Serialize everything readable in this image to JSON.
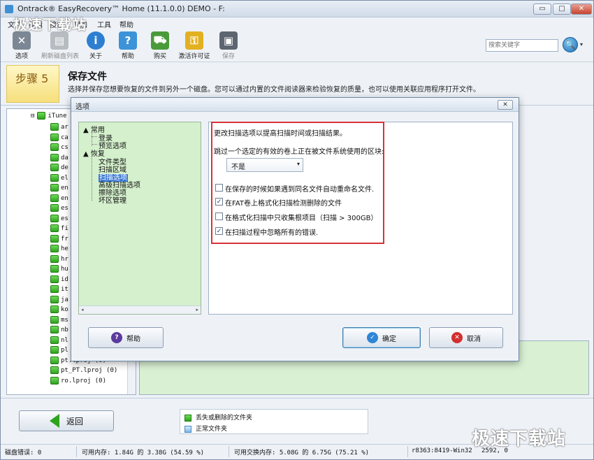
{
  "window": {
    "title": "Ontrack® EasyRecovery™ Home (11.1.0.0) DEMO - F:",
    "minimize_glyph": "▭",
    "maximize_glyph": "□",
    "close_glyph": "✕"
  },
  "menu": [
    "文件",
    "编辑",
    "搜索",
    "附加",
    "工具",
    "帮助"
  ],
  "toolbar": [
    {
      "label": "选项",
      "icon": "tools-icon"
    },
    {
      "label": "刷新磁盘列表",
      "icon": "disk-refresh-icon",
      "disabled": true
    },
    {
      "label": "关于",
      "icon": "info-icon"
    },
    {
      "label": "帮助",
      "icon": "help-icon"
    },
    {
      "label": "购买",
      "icon": "cart-icon"
    },
    {
      "label": "激活许可证",
      "icon": "key-icon"
    },
    {
      "label": "保存",
      "icon": "save-icon",
      "disabled": true
    }
  ],
  "search": {
    "placeholder": "搜索关键字",
    "button_glyph": "🔍",
    "chevron": "▾"
  },
  "step": {
    "label": "步骤 5",
    "title": "保存文件",
    "description": "选择并保存您想要恢复的文件到另外一个磁盘。您可以通过内置的文件阅读器来检验恢复的质量，也可以使用关联应用程序打开文件。"
  },
  "file_tree": {
    "root": "iTune",
    "items": [
      "ar",
      "ca",
      "cs",
      "da",
      "de",
      "el",
      "en",
      "en",
      "es",
      "es",
      "fi",
      "fr",
      "he",
      "hr",
      "hu",
      "id",
      "it",
      "ja",
      "ko",
      "ms",
      "nb",
      "nl",
      "pl",
      "pt.lproj (0)",
      "pt_PT.lproj (0)",
      "ro.lproj (0)"
    ]
  },
  "dialog": {
    "title": "选项",
    "close_glyph": "✕",
    "tree": {
      "groups": [
        {
          "label": "常用",
          "children": [
            "登录",
            "预览选项"
          ]
        },
        {
          "label": "恢复",
          "children": [
            "文件类型",
            "扫描区域",
            "扫描选项",
            "高级扫描选项",
            "擦除选项",
            "坏区管理"
          ]
        }
      ],
      "selected": "扫描选项",
      "scroll_left": "◂",
      "scroll_right": "▸"
    },
    "settings": {
      "heading": "更改扫描选项以提高扫描时间或扫描结果。",
      "skip_label": "跳过一个选定的有效的卷上正在被文件系统使用的区块:",
      "skip_value": "不是",
      "dropdown_arrow": "▾",
      "options": [
        {
          "label": "在保存的时候如果遇到同名文件自动重命名文件.",
          "checked": false
        },
        {
          "label": "在FAT卷上格式化扫描检测删除的文件",
          "checked": true
        },
        {
          "label": "在格式化扫描中只收集根项目（扫描 > 300GB）",
          "checked": false
        },
        {
          "label": "在扫描过程中忽略所有的错误.",
          "checked": true
        }
      ],
      "check_glyph": "✓"
    },
    "buttons": {
      "help": "帮助",
      "help_glyph": "?",
      "ok": "确定",
      "ok_glyph": "✓",
      "cancel": "取消",
      "cancel_glyph": "✕"
    }
  },
  "bottom": {
    "back_label": "返回",
    "legend": [
      "丢失或删除的文件夹",
      "正常文件夹"
    ]
  },
  "status": {
    "disk_errors": "磁盘错误: 0",
    "memory": "可用内存: 1.84G 的 3.38G (54.59 %)",
    "swap": "可用交换内存: 5.08G 的 6.75G (75.21 %)",
    "build": "r8363:8419-Win32",
    "year": "2592, 0"
  },
  "watermarks": {
    "top": "极速下载站",
    "bottom": "极速下载站"
  }
}
